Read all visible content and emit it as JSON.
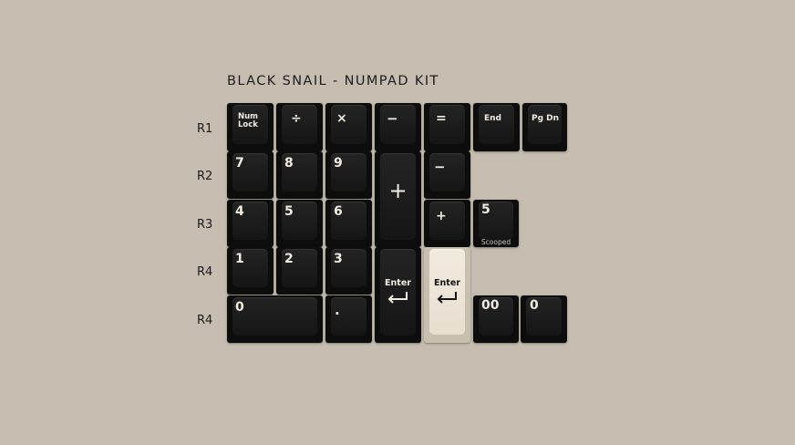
{
  "title": "BLACK SNAIL - NUMPAD KIT",
  "row_labels": [
    "R1",
    "R2",
    "R3",
    "R4",
    "R4"
  ],
  "keys": {
    "num_lock_line1": "Num",
    "num_lock_line2": "Lock",
    "divide": "÷",
    "multiply": "×",
    "minus_r1": "−",
    "equals": "=",
    "end": "End",
    "pg_dn": "Pg Dn",
    "seven": "7",
    "eight": "8",
    "nine": "9",
    "plus_tall": "+",
    "minus_r2": "−",
    "four": "4",
    "five": "5",
    "six": "6",
    "plus_small": "+",
    "five_scooped": "5",
    "scooped_label": "Scooped",
    "one": "1",
    "two": "2",
    "three": "3",
    "enter_black": "Enter",
    "enter_cream": "Enter",
    "zero_wide": "0",
    "dot": ".",
    "double_zero": "00",
    "zero_small": "0"
  },
  "colors": {
    "background": "#c4bdb0",
    "keycap_black": "#1b1b1b",
    "keycap_cream": "#e9e2d4",
    "legend_cream": "#f1ece2"
  }
}
